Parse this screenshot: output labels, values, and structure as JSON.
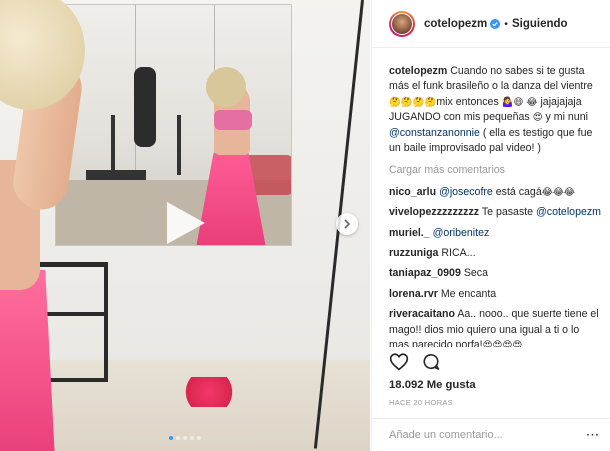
{
  "post": {
    "username": "cotelopezm",
    "verified_color": "#3897f0",
    "separator": "•",
    "follow_label": "Siguiendo",
    "caption": {
      "username": "cotelopezm",
      "text_1": "Cuando no sabes si te gusta más el funk brasileño o la danza del vientre",
      "emojis_1": "🤔🤔🤔🤔",
      "text_2": "mix entonces",
      "emojis_2": "🤷‍♀️😄",
      "emojis_3": "😂",
      "text_3": "jajajajaja JUGANDO con mis pequeñas",
      "emojis_4": "😍",
      "text_4": "y mi nuni",
      "mention": "@constanzanonnie",
      "text_5": "( ella es testigo que fue un baile improvisado pal video! )"
    },
    "load_more_label": "Cargar más comentarios",
    "comments": [
      {
        "user": "nico_arlu",
        "mention": "@josecofre",
        "text": "está cagá",
        "emojis": "😂😂😂"
      },
      {
        "user": "vivelopezzzzzzzzz",
        "text": "Te pasaste",
        "mention2": "@cotelopezm"
      },
      {
        "user": "muriel._",
        "mention": "@oribenitez"
      },
      {
        "user": "ruzzuniga",
        "text": "RICA..."
      },
      {
        "user": "taniapaz_0909",
        "text": "Seca"
      },
      {
        "user": "lorena.rvr",
        "text": "Me encanta"
      },
      {
        "user": "riveracaitano",
        "text": "Aa.. nooo.. que suerte tiene el mago!! dios mio quiero una igual a ti o lo mas parecido porfa!",
        "emojis": "😍😍😍😍"
      }
    ],
    "likes": "18.092 Me gusta",
    "time": "HACE 20 HORAS",
    "add_comment_placeholder": "Añade un comentario...",
    "more_label": "···"
  },
  "media": {
    "is_video": true,
    "carousel_count": 5,
    "carousel_active": 1
  },
  "icons": {
    "verified": "verified-badge-icon",
    "like": "heart-outline-icon",
    "comment": "speech-bubble-icon",
    "play": "play-icon",
    "next": "chevron-right-icon"
  }
}
